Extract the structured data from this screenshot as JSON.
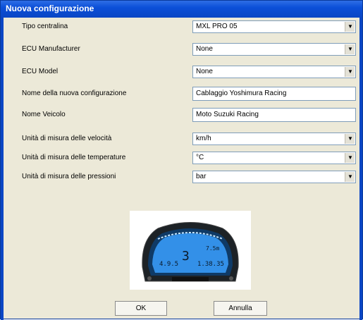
{
  "window": {
    "title": "Nuova configurazione"
  },
  "fields": [
    {
      "label": "Tipo centralina",
      "value": "MXL PRO  05",
      "kind": "combo"
    },
    {
      "label": "ECU Manufacturer",
      "value": "None",
      "kind": "combo"
    },
    {
      "label": "ECU Model",
      "value": "None",
      "kind": "combo"
    },
    {
      "label": "Nome della nuova configurazione",
      "value": "Cablaggio Yoshimura Racing",
      "kind": "text"
    },
    {
      "label": "Nome Veicolo",
      "value": "Moto Suzuki Racing",
      "kind": "text"
    },
    {
      "label": "Unità di misura delle velocità",
      "value": "km/h",
      "kind": "combo"
    },
    {
      "label": "Unità di misura delle temperature",
      "value": "°C",
      "kind": "combo"
    },
    {
      "label": "Unità di misura delle pressioni",
      "value": "bar",
      "kind": "combo"
    }
  ],
  "dash": {
    "gear": "3",
    "left_value": "4.9.5",
    "right_value": "1.38.35",
    "speed": "7.5m"
  },
  "buttons": {
    "ok": "OK",
    "cancel": "Annulla"
  },
  "colors": {
    "titlebar": "#0b4fd8",
    "dialog_bg": "#ece9d8",
    "lcd": "#3aa0ff"
  }
}
